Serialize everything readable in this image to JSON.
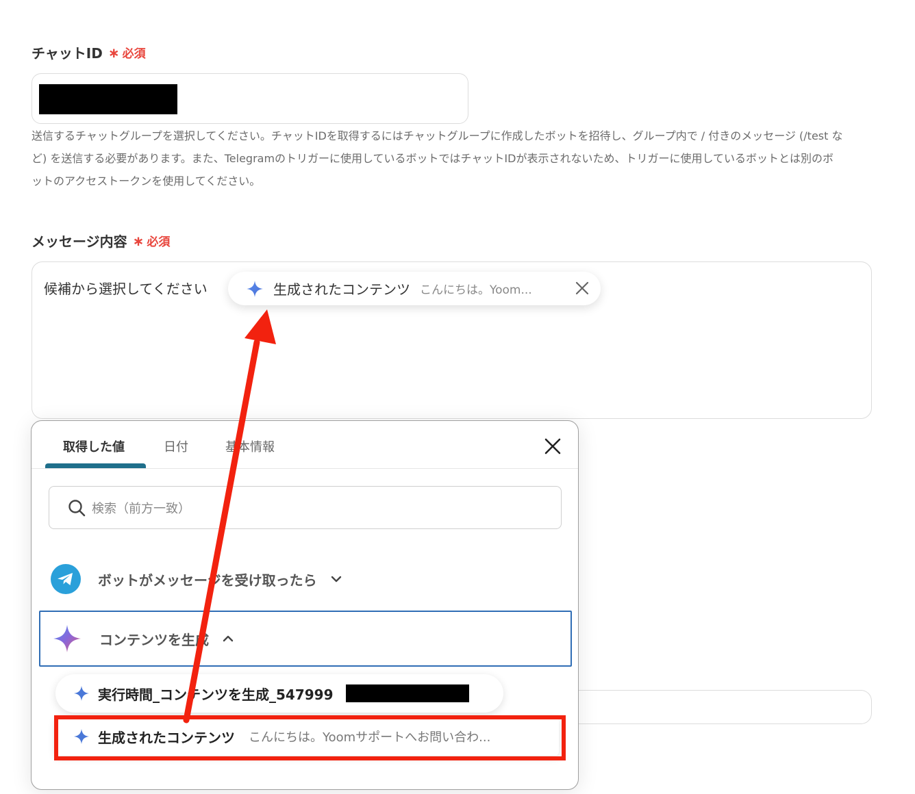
{
  "chat_id": {
    "label": "チャットID",
    "required_star": "∗",
    "required_text": "必須",
    "help_line1": "送信するチャットグループを選択してください。チャットIDを取得するにはチャットグループに作成したボットを招待し、グループ内で / 付きのメッセージ (/test な",
    "help_line2": "ど) を送信する必要があります。また、Telegramのトリガーに使用しているボットではチャットIDが表示されないため、トリガーに使用しているボットとは別のボ",
    "help_line3": "ットのアクセストークンを使用してください。"
  },
  "message": {
    "label": "メッセージ内容",
    "required_star": "∗",
    "required_text": "必須",
    "placeholder": "候補から選択してください",
    "chip_name": "生成されたコンテンツ",
    "chip_value": "こんにちは。Yoom..."
  },
  "panel": {
    "tabs": [
      {
        "label": "取得した値"
      },
      {
        "label": "日付"
      },
      {
        "label": "基本情報"
      }
    ],
    "search_placeholder": "検索（前方一致）",
    "groups": [
      {
        "label": "ボットがメッセージを受け取ったら",
        "icon": "telegram-icon"
      },
      {
        "label": "コンテンツを生成",
        "icon": "sparkle-icon"
      }
    ],
    "items": [
      {
        "name": "実行時間_コンテンツを生成_547999",
        "value": ""
      },
      {
        "name": "生成されたコンテンツ",
        "value": "こんにちは。Yoomサポートへお問い合わ..."
      }
    ]
  },
  "colors": {
    "required": "#e8453c",
    "active_tab": "#1f6f8b",
    "group_border": "#2f6db5",
    "annotation": "#f2220f",
    "telegram": "#2aa0da"
  }
}
